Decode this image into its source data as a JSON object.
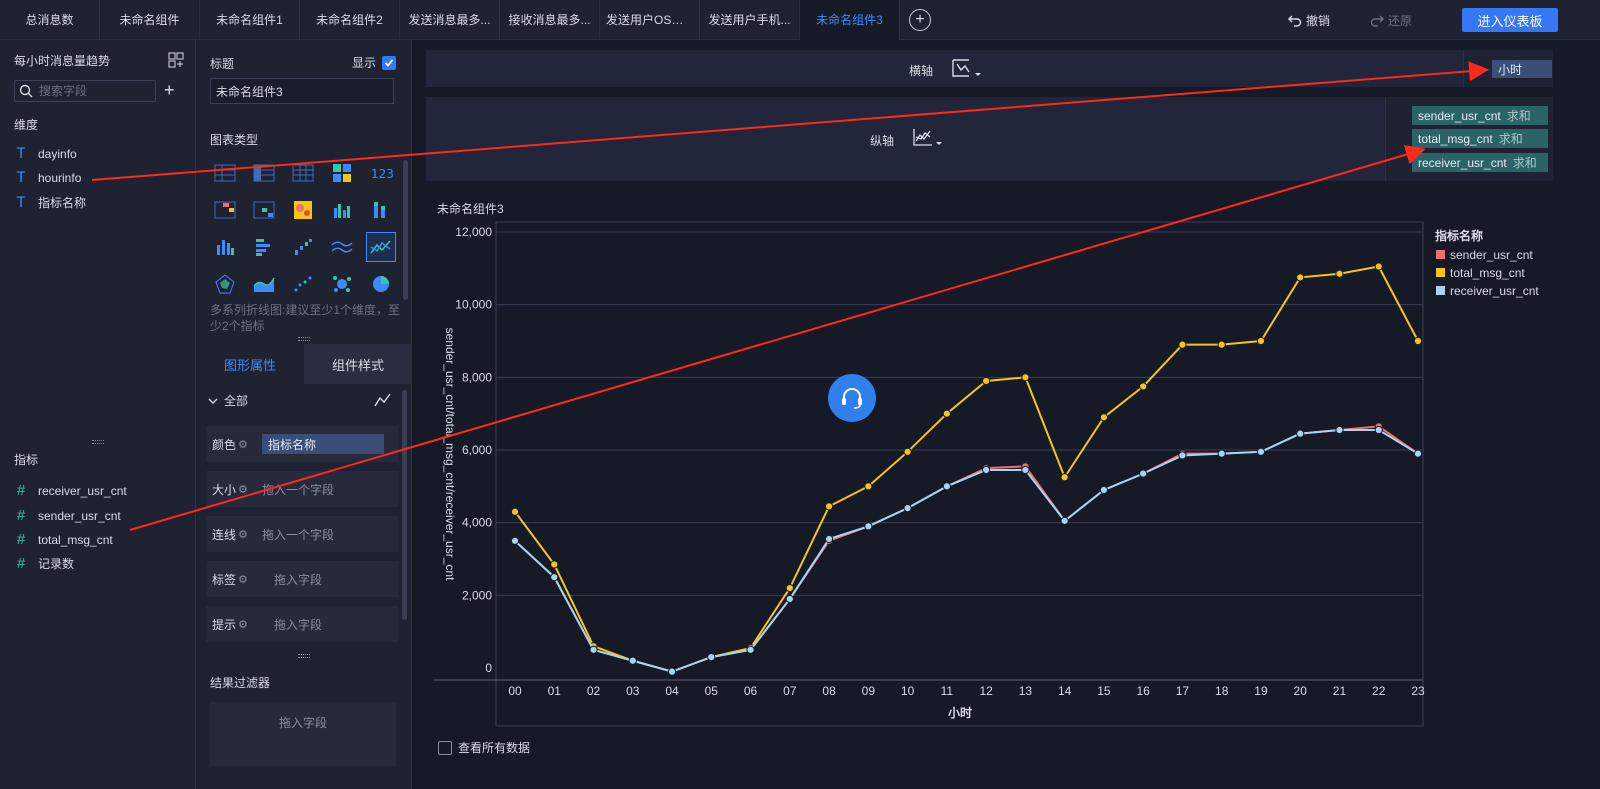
{
  "tabs": [
    {
      "label": "总消息数"
    },
    {
      "label": "未命名组件"
    },
    {
      "label": "未命名组件1"
    },
    {
      "label": "未命名组件2"
    },
    {
      "label": "发送消息最多..."
    },
    {
      "label": "接收消息最多..."
    },
    {
      "label": "发送用户OS系..."
    },
    {
      "label": "发送用户手机..."
    },
    {
      "label": "未命名组件3"
    }
  ],
  "toolbar": {
    "undo": "撤销",
    "redo": "还原",
    "dashboard": "进入仪表板"
  },
  "left_panel": {
    "title": "每小时消息量趋势",
    "search_placeholder": "搜索字段",
    "dimensions_label": "维度",
    "dimensions": [
      "dayinfo",
      "hourinfo",
      "指标名称"
    ],
    "metrics_label": "指标",
    "metrics": [
      "receiver_usr_cnt",
      "sender_usr_cnt",
      "total_msg_cnt",
      "记录数"
    ]
  },
  "mid_panel": {
    "title_label": "标题",
    "show_label": "显示",
    "title_value": "未命名组件3",
    "chart_types_label": "图表类型",
    "chart_hint": "多系列折线图:建议至少1个维度，至少2个指标",
    "tab_graphic": "图形属性",
    "tab_style": "组件样式",
    "all_label": "全部",
    "props": [
      {
        "label": "颜色",
        "value": "指标名称"
      },
      {
        "label": "大小",
        "value": "拖入一个字段"
      },
      {
        "label": "连线",
        "value": "拖入一个字段"
      },
      {
        "label": "标签",
        "value": "拖入字段"
      },
      {
        "label": "提示",
        "value": "拖入字段"
      }
    ],
    "filter_label": "结果过滤器",
    "filter_placeholder": "拖入字段"
  },
  "axes": {
    "x_label": "横轴",
    "x_field": "小时",
    "y_label": "纵轴",
    "y_fields": [
      {
        "name": "sender_usr_cnt",
        "agg": "求和"
      },
      {
        "name": "total_msg_cnt",
        "agg": "求和"
      },
      {
        "name": "receiver_usr_cnt",
        "agg": "求和"
      }
    ]
  },
  "chart_title": "未命名组件3",
  "view_all": "查看所有数据",
  "colors": {
    "sender": "#f07070",
    "total": "#f5c518",
    "receiver": "#a8d4f0",
    "accent": "#3478f6"
  },
  "chart_data": {
    "type": "line",
    "title": "",
    "xlabel": "小时",
    "ylabel": "sender_usr_cnt/total_msg_cnt/receiver_usr_cnt",
    "ylim": [
      0,
      12000
    ],
    "yticks": [
      "0",
      "2,000",
      "4,000",
      "6,000",
      "8,000",
      "10,000",
      "12,000"
    ],
    "categories": [
      "00",
      "01",
      "02",
      "03",
      "04",
      "05",
      "06",
      "07",
      "08",
      "09",
      "10",
      "11",
      "12",
      "13",
      "14",
      "15",
      "16",
      "17",
      "18",
      "19",
      "20",
      "21",
      "22",
      "23"
    ],
    "legend_title": "指标名称",
    "legend_position": "right",
    "series": [
      {
        "name": "sender_usr_cnt",
        "color": "#f07070",
        "values": [
          3500,
          2500,
          500,
          200,
          -100,
          300,
          500,
          1900,
          3500,
          3900,
          4400,
          5000,
          5500,
          5550,
          4050,
          4900,
          5350,
          5900,
          5900,
          5950,
          6450,
          6550,
          6650,
          5900
        ]
      },
      {
        "name": "total_msg_cnt",
        "color": "#f5c518",
        "values": [
          4300,
          2850,
          600,
          200,
          -100,
          300,
          550,
          2200,
          4450,
          5000,
          5950,
          7000,
          7900,
          8000,
          5250,
          6900,
          7750,
          8900,
          8900,
          9000,
          10750,
          10850,
          11050,
          9000
        ]
      },
      {
        "name": "receiver_usr_cnt",
        "color": "#a8d4f0",
        "values": [
          3500,
          2500,
          500,
          200,
          -100,
          300,
          500,
          1900,
          3550,
          3900,
          4400,
          5000,
          5450,
          5450,
          4050,
          4900,
          5350,
          5850,
          5900,
          5950,
          6450,
          6550,
          6550,
          5900
        ]
      }
    ]
  }
}
